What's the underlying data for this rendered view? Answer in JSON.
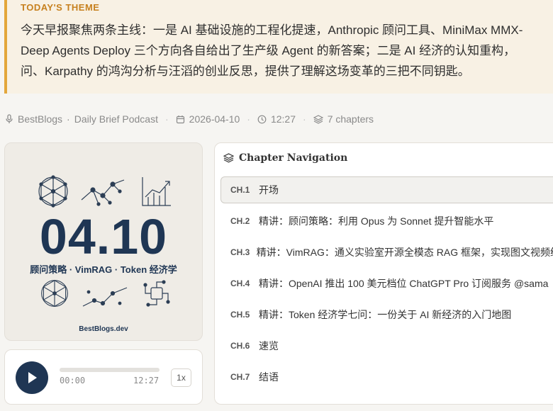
{
  "theme": {
    "label": "TODAY'S THEME",
    "lines": [
      "今天早报聚焦两条主线：一是 AI 基础设施的工程化提速，Anthropic 顾问工具、MiniMax MMX-",
      "Deep Agents Deploy 三个方向各自给出了生产级 Agent 的新答案；二是 AI 经济的认知重构，",
      "问、Karpathy 的鸿沟分析与汪滔的创业反思，提供了理解这场变革的三把不同钥匙。"
    ]
  },
  "meta": {
    "source": "BestBlogs",
    "podcast": "Daily Brief Podcast",
    "date": "2026-04-10",
    "time": "12:27",
    "chapters": "7 chapters"
  },
  "cover": {
    "date": "04.10",
    "subtitle": "顾问策略 · VimRAG · Token 经济学",
    "site": "BestBlogs.dev"
  },
  "player": {
    "current": "00:00",
    "duration": "12:27",
    "speed": "1x",
    "progress": 0
  },
  "chapter_nav": {
    "title": "Chapter Navigation",
    "items": [
      {
        "num": "CH.1",
        "title": "开场"
      },
      {
        "num": "CH.2",
        "title": "精讲：顾问策略：利用 Opus 为 Sonnet 提升智能水平"
      },
      {
        "num": "CH.3",
        "title": "精讲：VimRAG：通义实验室开源全模态 RAG 框架，实现图文视频统"
      },
      {
        "num": "CH.4",
        "title": "精讲：OpenAI 推出 100 美元档位 ChatGPT Pro 订阅服务 @sama"
      },
      {
        "num": "CH.5",
        "title": "精讲：Token 经济学七问：一份关于 AI 新经济的入门地图"
      },
      {
        "num": "CH.6",
        "title": "速览"
      },
      {
        "num": "CH.7",
        "title": "结语"
      }
    ],
    "active_index": 0
  },
  "colors": {
    "accent": "#e3a73c",
    "navy": "#1f3654",
    "theme_bg": "#f8f1e4"
  }
}
